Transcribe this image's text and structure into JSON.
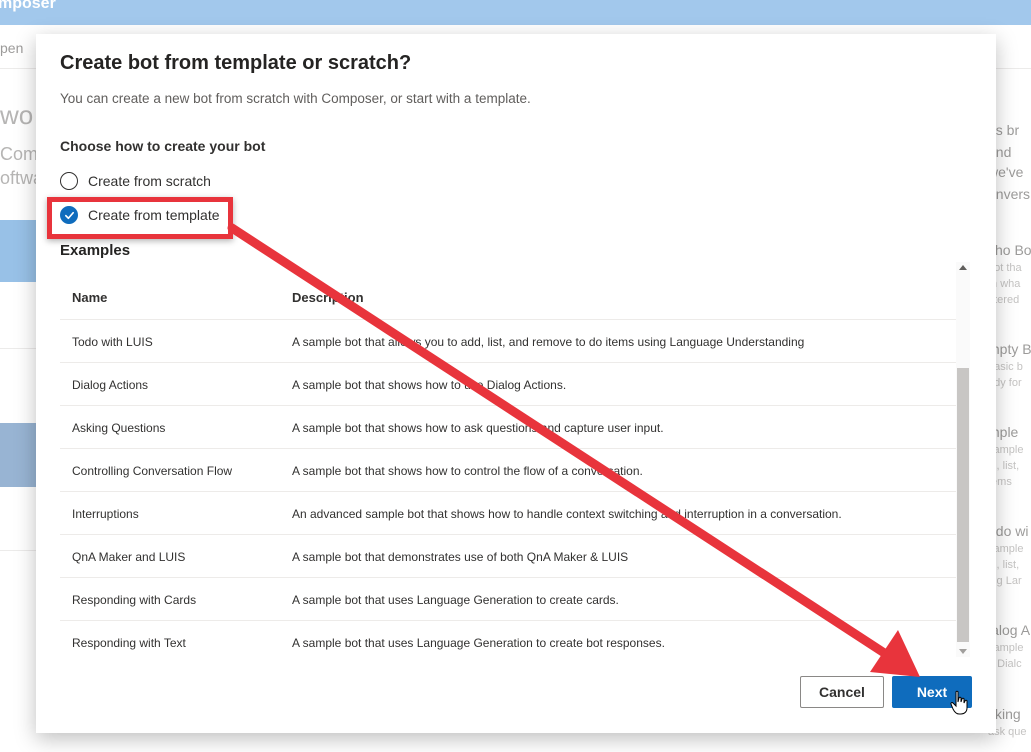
{
  "app": {
    "title": "mposer",
    "open_label": "pen",
    "bg_heading": "wo",
    "bg_line1": "Comp",
    "bg_line2": "oftwa"
  },
  "right_panel": {
    "intro": [
      "es br",
      "and",
      "we've",
      "onvers"
    ],
    "items": [
      {
        "title": "cho Bo",
        "lines": [
          "bot tha",
          "th wha",
          "ntered"
        ]
      },
      {
        "title": "mpty B",
        "lines": [
          "basic b",
          "ady for"
        ]
      },
      {
        "title": "mple",
        "lines": [
          "sample",
          "ld, list,",
          "tems"
        ]
      },
      {
        "title": "odo wi",
        "lines": [
          "sample",
          "ld, list,",
          "ing Lar"
        ]
      },
      {
        "title": "ialog A",
        "lines": [
          "sample",
          "e Dialc"
        ]
      },
      {
        "title": "sking",
        "lines": [
          "ask que"
        ]
      }
    ]
  },
  "dialog": {
    "title": "Create bot from template or scratch?",
    "subtitle": "You can create a new bot from scratch with Composer, or start with a template.",
    "choose_label": "Choose how to create your bot",
    "options": [
      {
        "label": "Create from scratch",
        "selected": false
      },
      {
        "label": "Create from template",
        "selected": true
      }
    ],
    "examples_label": "Examples",
    "columns": {
      "name": "Name",
      "description": "Description"
    },
    "rows": [
      {
        "name": "Todo with LUIS",
        "description": "A sample bot that allows you to add, list, and remove to do items using Language Understanding"
      },
      {
        "name": "Dialog Actions",
        "description": "A sample bot that shows how to use Dialog Actions."
      },
      {
        "name": "Asking Questions",
        "description": "A sample bot that shows how to ask questions and capture user input."
      },
      {
        "name": "Controlling Conversation Flow",
        "description": "A sample bot that shows how to control the flow of a conversation."
      },
      {
        "name": "Interruptions",
        "description": "An advanced sample bot that shows how to handle context switching and interruption in a conversation."
      },
      {
        "name": "QnA Maker and LUIS",
        "description": "A sample bot that demonstrates use of both QnA Maker & LUIS"
      },
      {
        "name": "Responding with Cards",
        "description": "A sample bot that uses Language Generation to create cards."
      },
      {
        "name": "Responding with Text",
        "description": "A sample bot that uses Language Generation to create bot responses."
      }
    ],
    "cancel_label": "Cancel",
    "next_label": "Next"
  },
  "colors": {
    "accent": "#0f6cbd",
    "annotation": "#e8343c",
    "header": "#6aa6e0"
  }
}
